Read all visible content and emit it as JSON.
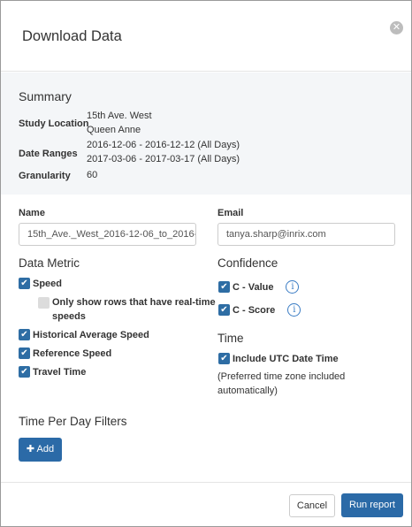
{
  "dialog": {
    "title": "Download Data",
    "close_glyph": "✕"
  },
  "summary": {
    "title": "Summary",
    "study_location_label": "Study Location",
    "study_location_line1": "15th Ave. West",
    "study_location_line2": "Queen Anne",
    "date_ranges_label": "Date Ranges",
    "date_range_1": "2016-12-06 - 2016-12-12 (All Days)",
    "date_range_2": "2017-03-06 - 2017-03-17 (All Days)",
    "granularity_label": "Granularity",
    "granularity_value": "60"
  },
  "form": {
    "name_label": "Name",
    "name_value": "15th_Ave._West_2016-12-06_to_2016-",
    "email_label": "Email",
    "email_value": "tanya.sharp@inrix.com"
  },
  "data_metric": {
    "title": "Data Metric",
    "speed": "Speed",
    "realtime_line1": "Only show rows that have real-time",
    "realtime_line2": "speeds",
    "historical": "Historical Average Speed",
    "reference": "Reference Speed",
    "travel_time": "Travel Time"
  },
  "confidence": {
    "title": "Confidence",
    "c_value": "C - Value",
    "c_score": "C - Score"
  },
  "time": {
    "title": "Time",
    "utc_label": "Include UTC Date Time",
    "note_line1": "(Preferred time zone included",
    "note_line2": "automatically)"
  },
  "filters": {
    "title": "Time Per Day Filters",
    "add_label": "Add"
  },
  "footer": {
    "cancel_label": "Cancel",
    "run_label": "Run report"
  },
  "icons": {
    "check": "check-icon",
    "info": "info-icon",
    "plus": "plus-icon",
    "close": "close-icon"
  },
  "colors": {
    "primary": "#2b6aa7",
    "summary_bg": "#f4f6f8",
    "checkbox": "#2e6da4"
  }
}
